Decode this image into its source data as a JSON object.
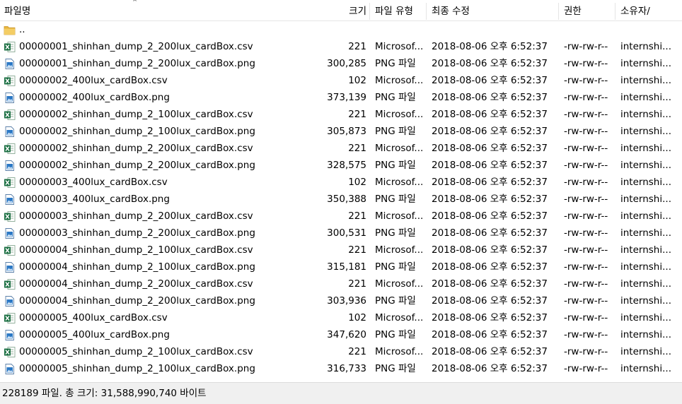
{
  "header": {
    "name": "파일명",
    "size": "크기",
    "type": "파일 유형",
    "date": "최종 수정",
    "perm": "권한",
    "owner": "소유자/"
  },
  "parent_dir": "..",
  "files": [
    {
      "name": "00000001_shinhan_dump_2_200lux_cardBox.csv",
      "size": "221",
      "type": "Microsof...",
      "date": "2018-08-06 오후 6:52:37",
      "perm": "-rw-rw-r--",
      "owner": "internshi...",
      "icon": "excel-csv-icon"
    },
    {
      "name": "00000001_shinhan_dump_2_200lux_cardBox.png",
      "size": "300,285",
      "type": "PNG 파일",
      "date": "2018-08-06 오후 6:52:37",
      "perm": "-rw-rw-r--",
      "owner": "internshi...",
      "icon": "image-png-icon"
    },
    {
      "name": "00000002_400lux_cardBox.csv",
      "size": "102",
      "type": "Microsof...",
      "date": "2018-08-06 오후 6:52:37",
      "perm": "-rw-rw-r--",
      "owner": "internshi...",
      "icon": "excel-csv-icon"
    },
    {
      "name": "00000002_400lux_cardBox.png",
      "size": "373,139",
      "type": "PNG 파일",
      "date": "2018-08-06 오후 6:52:37",
      "perm": "-rw-rw-r--",
      "owner": "internshi...",
      "icon": "image-png-icon"
    },
    {
      "name": "00000002_shinhan_dump_2_100lux_cardBox.csv",
      "size": "221",
      "type": "Microsof...",
      "date": "2018-08-06 오후 6:52:37",
      "perm": "-rw-rw-r--",
      "owner": "internshi...",
      "icon": "excel-csv-icon"
    },
    {
      "name": "00000002_shinhan_dump_2_100lux_cardBox.png",
      "size": "305,873",
      "type": "PNG 파일",
      "date": "2018-08-06 오후 6:52:37",
      "perm": "-rw-rw-r--",
      "owner": "internshi...",
      "icon": "image-png-icon"
    },
    {
      "name": "00000002_shinhan_dump_2_200lux_cardBox.csv",
      "size": "221",
      "type": "Microsof...",
      "date": "2018-08-06 오후 6:52:37",
      "perm": "-rw-rw-r--",
      "owner": "internshi...",
      "icon": "excel-csv-icon"
    },
    {
      "name": "00000002_shinhan_dump_2_200lux_cardBox.png",
      "size": "328,575",
      "type": "PNG 파일",
      "date": "2018-08-06 오후 6:52:37",
      "perm": "-rw-rw-r--",
      "owner": "internshi...",
      "icon": "image-png-icon"
    },
    {
      "name": "00000003_400lux_cardBox.csv",
      "size": "102",
      "type": "Microsof...",
      "date": "2018-08-06 오후 6:52:37",
      "perm": "-rw-rw-r--",
      "owner": "internshi...",
      "icon": "excel-csv-icon"
    },
    {
      "name": "00000003_400lux_cardBox.png",
      "size": "350,388",
      "type": "PNG 파일",
      "date": "2018-08-06 오후 6:52:37",
      "perm": "-rw-rw-r--",
      "owner": "internshi...",
      "icon": "image-png-icon"
    },
    {
      "name": "00000003_shinhan_dump_2_200lux_cardBox.csv",
      "size": "221",
      "type": "Microsof...",
      "date": "2018-08-06 오후 6:52:37",
      "perm": "-rw-rw-r--",
      "owner": "internshi...",
      "icon": "excel-csv-icon"
    },
    {
      "name": "00000003_shinhan_dump_2_200lux_cardBox.png",
      "size": "300,531",
      "type": "PNG 파일",
      "date": "2018-08-06 오후 6:52:37",
      "perm": "-rw-rw-r--",
      "owner": "internshi...",
      "icon": "image-png-icon"
    },
    {
      "name": "00000004_shinhan_dump_2_100lux_cardBox.csv",
      "size": "221",
      "type": "Microsof...",
      "date": "2018-08-06 오후 6:52:37",
      "perm": "-rw-rw-r--",
      "owner": "internshi...",
      "icon": "excel-csv-icon"
    },
    {
      "name": "00000004_shinhan_dump_2_100lux_cardBox.png",
      "size": "315,181",
      "type": "PNG 파일",
      "date": "2018-08-06 오후 6:52:37",
      "perm": "-rw-rw-r--",
      "owner": "internshi...",
      "icon": "image-png-icon"
    },
    {
      "name": "00000004_shinhan_dump_2_200lux_cardBox.csv",
      "size": "221",
      "type": "Microsof...",
      "date": "2018-08-06 오후 6:52:37",
      "perm": "-rw-rw-r--",
      "owner": "internshi...",
      "icon": "excel-csv-icon"
    },
    {
      "name": "00000004_shinhan_dump_2_200lux_cardBox.png",
      "size": "303,936",
      "type": "PNG 파일",
      "date": "2018-08-06 오후 6:52:37",
      "perm": "-rw-rw-r--",
      "owner": "internshi...",
      "icon": "image-png-icon"
    },
    {
      "name": "00000005_400lux_cardBox.csv",
      "size": "102",
      "type": "Microsof...",
      "date": "2018-08-06 오후 6:52:37",
      "perm": "-rw-rw-r--",
      "owner": "internshi...",
      "icon": "excel-csv-icon"
    },
    {
      "name": "00000005_400lux_cardBox.png",
      "size": "347,620",
      "type": "PNG 파일",
      "date": "2018-08-06 오후 6:52:37",
      "perm": "-rw-rw-r--",
      "owner": "internshi...",
      "icon": "image-png-icon"
    },
    {
      "name": "00000005_shinhan_dump_2_100lux_cardBox.csv",
      "size": "221",
      "type": "Microsof...",
      "date": "2018-08-06 오후 6:52:37",
      "perm": "-rw-rw-r--",
      "owner": "internshi...",
      "icon": "excel-csv-icon"
    },
    {
      "name": "00000005_shinhan_dump_2_100lux_cardBox.png",
      "size": "316,733",
      "type": "PNG 파일",
      "date": "2018-08-06 오후 6:52:37",
      "perm": "-rw-rw-r--",
      "owner": "internshi...",
      "icon": "image-png-icon"
    }
  ],
  "status_text": "228189 파일. 총 크기: 31,588,990,740 바이트",
  "colors": {
    "excel_green": "#1e7145",
    "png_blue": "#2b78c5",
    "folder_yellow": "#e8b53c",
    "status_bg": "#f0f0f0"
  }
}
